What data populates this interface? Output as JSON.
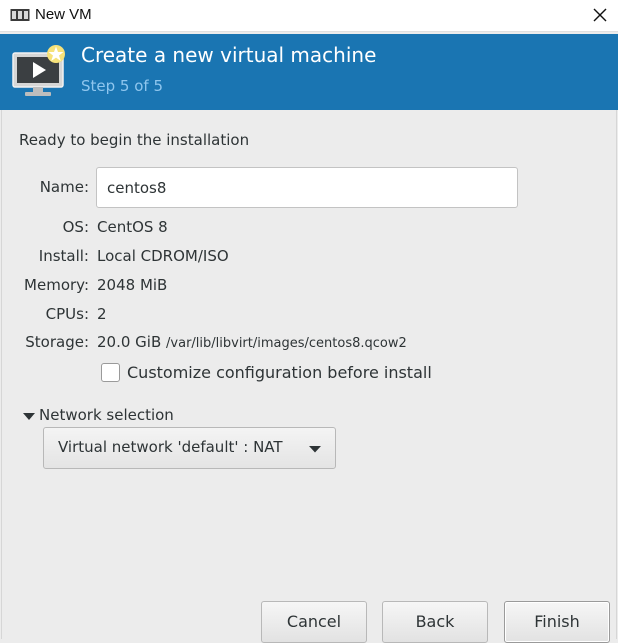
{
  "window": {
    "title": "New VM",
    "app_icon": "virt-manager-icon",
    "close_icon": "close-icon"
  },
  "banner": {
    "icon": "vm-monitor-new-icon",
    "heading": "Create a new virtual machine",
    "step": "Step 5 of 5",
    "background": "#1a75b2",
    "step_color": "#8fc6ee"
  },
  "summary": {
    "ready_text": "Ready to begin the installation",
    "name_label": "Name:",
    "name_value": "centos8",
    "os_label": "OS:",
    "os_value": "CentOS 8",
    "install_label": "Install:",
    "install_value": "Local CDROM/ISO",
    "memory_label": "Memory:",
    "memory_value": "2048 MiB",
    "cpus_label": "CPUs:",
    "cpus_value": "2",
    "storage_label": "Storage:",
    "storage_size": "20.0 GiB",
    "storage_path": "/var/lib/libvirt/images/centos8.qcow2",
    "customize_label": "Customize configuration before install",
    "customize_checked": false
  },
  "network": {
    "section_label": "Network selection",
    "expander_icon": "triangle-down-icon",
    "selected": "Virtual network 'default' : NAT",
    "dropdown_icon": "dropdown-arrow-icon"
  },
  "buttons": {
    "cancel": "Cancel",
    "back": "Back",
    "finish": "Finish"
  }
}
